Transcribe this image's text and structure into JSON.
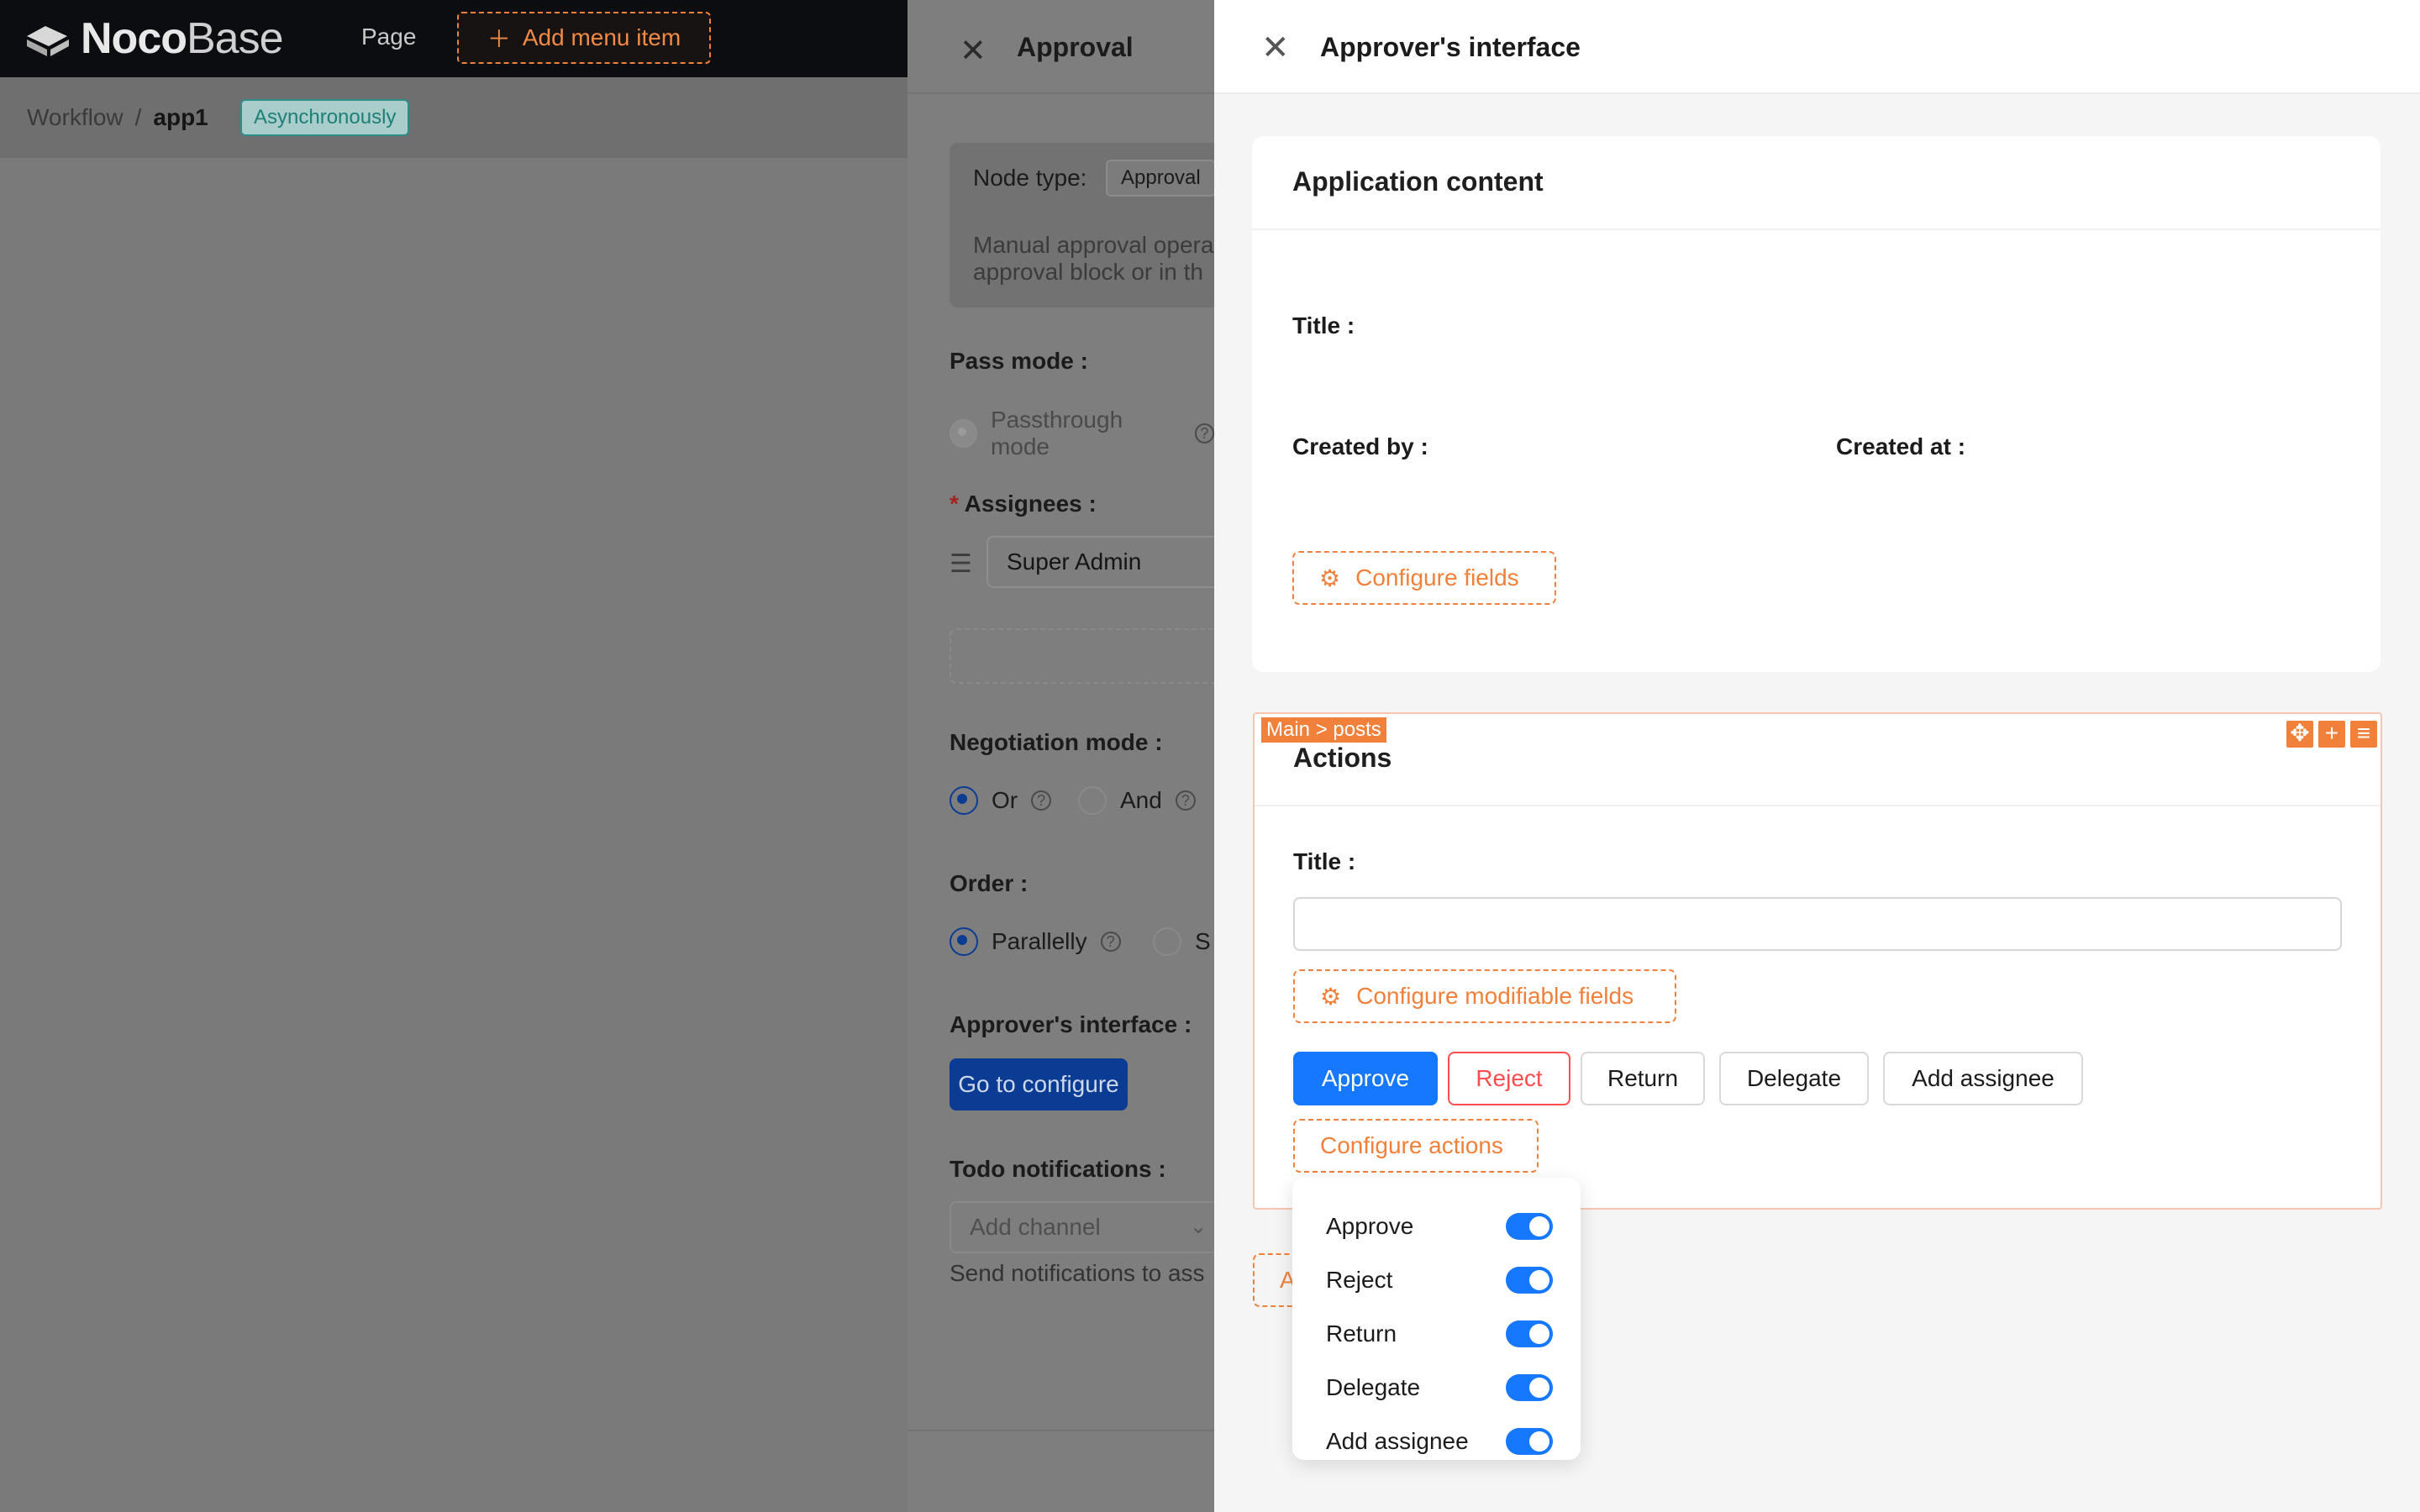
{
  "topbar": {
    "logo_bold": "Noco",
    "logo_light": "Base",
    "nav_page": "Page",
    "add_menu_item": "Add menu item"
  },
  "breadcrumb": {
    "root": "Workflow",
    "separator": "/",
    "current": "app1",
    "badge": "Asynchronously"
  },
  "approval_drawer": {
    "title": "Approval",
    "node_type_label": "Node type:",
    "node_type_value": "Approval",
    "node_desc_line1": "Manual approval opera",
    "node_desc_line2": "approval block or in th",
    "pass_mode_label": "Pass mode",
    "pass_mode_option": "Passthrough mode",
    "assignees_label": "Assignees",
    "assignee_value": "Super Admin",
    "negotiation_label": "Negotiation mode",
    "negotiation_or": "Or",
    "negotiation_and": "And",
    "order_label": "Order",
    "order_parallelly": "Parallelly",
    "order_second": "S",
    "approver_interface_label": "Approver's interface",
    "configure_button": "Go to configure",
    "todo_label": "Todo notifications",
    "channel_placeholder": "Add channel",
    "channel_hint": "Send notifications to ass"
  },
  "right_drawer": {
    "title": "Approver's interface",
    "application_card": {
      "title": "Application content",
      "field_title": "Title",
      "field_created_by": "Created by",
      "field_created_at": "Created at",
      "configure_fields": "Configure fields"
    },
    "actions_card": {
      "tag": "Main > posts",
      "title": "Actions",
      "field_title": "Title",
      "configure_modifiable": "Configure modifiable fields",
      "buttons": {
        "approve": "Approve",
        "reject": "Reject",
        "return": "Return",
        "delegate": "Delegate",
        "add_assignee": "Add assignee"
      },
      "configure_actions": "Configure actions"
    },
    "partial_button": "A"
  },
  "actions_popover": {
    "items": [
      {
        "label": "Approve",
        "enabled": true
      },
      {
        "label": "Reject",
        "enabled": true
      },
      {
        "label": "Return",
        "enabled": true
      },
      {
        "label": "Delegate",
        "enabled": true
      },
      {
        "label": "Add assignee",
        "enabled": true
      }
    ]
  },
  "colors": {
    "primary": "#1677ff",
    "danger": "#ff4d4f",
    "designer_accent": "#f0803a",
    "topbar": "#0b0d10"
  }
}
